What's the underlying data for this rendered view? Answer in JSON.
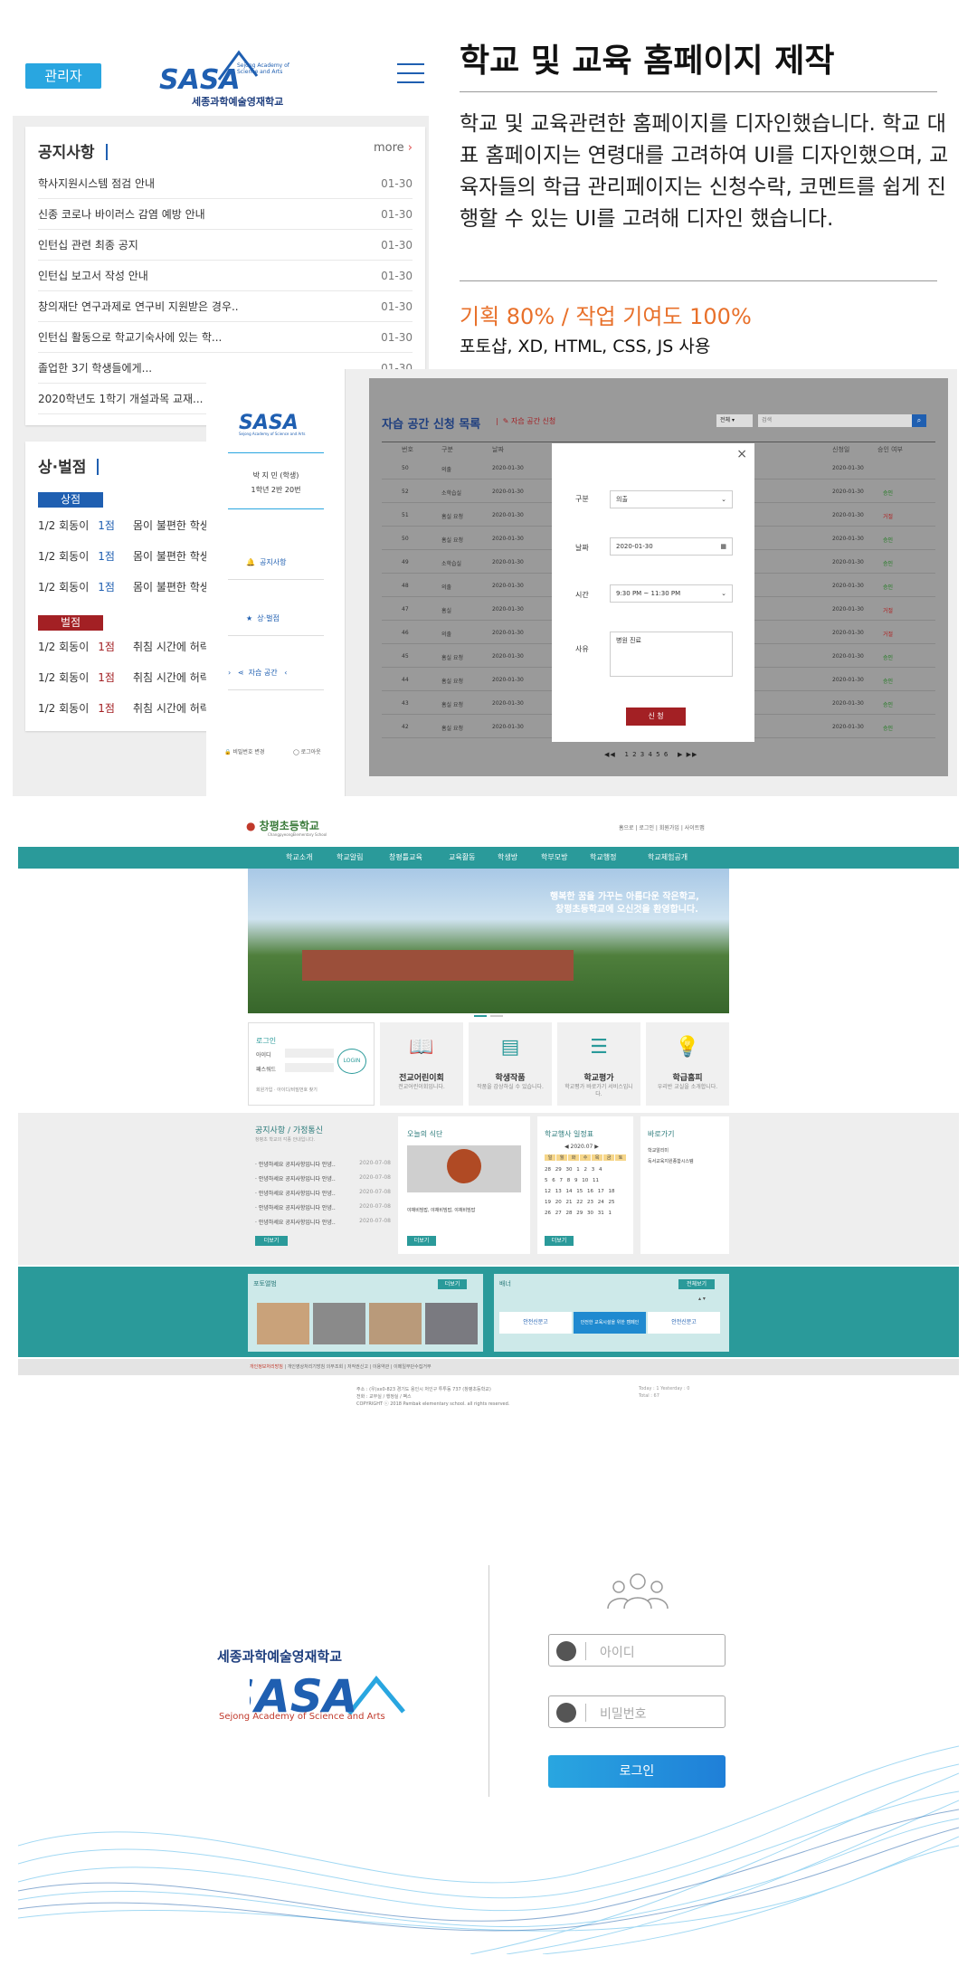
{
  "section1": {
    "admin_button": "관리자",
    "school_logo_text": "SASA",
    "school_name": "세종과학예술영재학교",
    "school_name_en_1": "Sejong Academy of",
    "school_name_en_2": "Science and Arts",
    "notice": {
      "title": "공지사항",
      "more": "more",
      "rows": [
        {
          "title": "학사지원시스템 점검 안내",
          "date": "01-30"
        },
        {
          "title": "신종 코로나 바이러스 감염 예방 안내",
          "date": "01-30"
        },
        {
          "title": "인턴십 관련 최종 공지",
          "date": "01-30"
        },
        {
          "title": "인턴십 보고서 작성 안내",
          "date": "01-30"
        },
        {
          "title": "창의재단 연구과제로 연구비 지원받은 경우..",
          "date": "01-30"
        },
        {
          "title": "인턴십 활동으로 학교기숙사에 있는 학...",
          "date": "01-30"
        },
        {
          "title": "졸업한 3기 학생들에게...",
          "date": "01-30"
        },
        {
          "title": "2020학년도 1학기 개설과목 교재...",
          "date": "01-30"
        }
      ]
    },
    "points": {
      "title": "상·벌점",
      "merit_label": "상점",
      "demerit_label": "벌점",
      "merit_rows": [
        {
          "period": "1/2 회동이",
          "score": "1점",
          "reason": "몸이 불편한 학생"
        },
        {
          "period": "1/2 회동이",
          "score": "1점",
          "reason": "몸이 불편한 학생"
        },
        {
          "period": "1/2 회동이",
          "score": "1점",
          "reason": "몸이 불편한 학생"
        }
      ],
      "demerit_rows": [
        {
          "period": "1/2 회동이",
          "score": "1점",
          "reason": "취침 시간에 허락"
        },
        {
          "period": "1/2 회동이",
          "score": "1점",
          "reason": "취침 시간에 허락"
        },
        {
          "period": "1/2 회동이",
          "score": "1점",
          "reason": "취침 시간에 허락"
        }
      ]
    }
  },
  "desktop_mock": {
    "logo": "SASA",
    "logo_sub": "Sejong Academy of Science and Arts",
    "user_name": "박 지 민 (학생)",
    "user_class": "1학년 2반 20번",
    "menu": [
      "공지사항",
      "상·벌점",
      "자습 공간"
    ],
    "footer_links": [
      "비밀번호 변경",
      "로그아웃"
    ],
    "page_title": "자습 공간 신청 목록",
    "apply_link": "자습 공간 신청",
    "filter_select": "전체",
    "search_placeholder": "검색",
    "columns": [
      "번호",
      "구분",
      "날짜",
      "신청일",
      "승인 여부"
    ],
    "rows": [
      {
        "no": "50",
        "type": "의출",
        "date": "2020-01-30",
        "applied": "2020-01-30",
        "status": ""
      },
      {
        "no": "52",
        "type": "소학습실",
        "date": "2020-01-30",
        "applied": "2020-01-30",
        "status": "승인"
      },
      {
        "no": "51",
        "type": "홈실 요청",
        "date": "2020-01-30",
        "applied": "2020-01-30",
        "status": "거절"
      },
      {
        "no": "50",
        "type": "홈실 요청",
        "date": "2020-01-30",
        "applied": "2020-01-30",
        "status": "승인"
      },
      {
        "no": "49",
        "type": "소학습실",
        "date": "2020-01-30",
        "applied": "2020-01-30",
        "status": "승인"
      },
      {
        "no": "48",
        "type": "의출",
        "date": "2020-01-30",
        "applied": "2020-01-30",
        "status": "승인"
      },
      {
        "no": "47",
        "type": "홈실",
        "date": "2020-01-30",
        "applied": "2020-01-30",
        "status": "거절"
      },
      {
        "no": "46",
        "type": "의출",
        "date": "2020-01-30",
        "applied": "2020-01-30",
        "status": "거절"
      },
      {
        "no": "45",
        "type": "홈실 요청",
        "date": "2020-01-30",
        "applied": "2020-01-30",
        "status": "승인"
      },
      {
        "no": "44",
        "type": "홈실 요청",
        "date": "2020-01-30",
        "applied": "2020-01-30",
        "status": "승인"
      },
      {
        "no": "43",
        "type": "홈실 요청",
        "date": "2020-01-30",
        "applied": "2020-01-30",
        "status": "승인"
      },
      {
        "no": "42",
        "type": "홈실 요청",
        "date": "2020-01-30",
        "applied": "2020-01-30",
        "status": "승인"
      }
    ],
    "pagination": "1 2 3 4 5 6",
    "modal": {
      "type_label": "구분",
      "type_value": "의출",
      "date_label": "날짜",
      "date_value": "2020-01-30",
      "time_label": "시간",
      "time_value": "9:30 PM ~ 11:30 PM",
      "reason_label": "사유",
      "reason_value": "병원 진료",
      "submit": "신 청"
    }
  },
  "intro": {
    "title": "학교 및 교육 홈페이지 제작",
    "body": "학교 및 교육관련한 홈페이지를 디자인했습니다. 학교 대표 홈페이지는 연령대를 고려하여 UI를 디자인했으며, 교육자들의 학급 관리페이지는 신청수락, 코멘트를 쉽게 진행할 수 있는 UI를 고려해 디자인 했습니다.",
    "contribution": "기획 80% / 작업 기여도 100%",
    "tools": "포토샵, XD, HTML, CSS, JS 사용"
  },
  "school_site": {
    "name": "창평초등학교",
    "name_en": "ChangpyeongElementary School",
    "top_links": [
      "홈으로",
      "로그인",
      "회원가입",
      "사이트맵"
    ],
    "gnb": [
      "학교소개",
      "학교알림",
      "창평틀교육",
      "교육활동",
      "학생방",
      "학부모방",
      "학교행정",
      "학교체험공개"
    ],
    "hero_line1": "행복한 꿈을 가꾸는 아름다운 작은학교,",
    "hero_line2": "창평초등학교에 오신것을 환영합니다.",
    "login": {
      "title": "로그인",
      "id": "아이디",
      "pw": "패스워드",
      "button": "LOGIN",
      "links": "회원가입 · 아이디/비밀번호 찾기"
    },
    "quick": [
      {
        "title": "전교어린이회",
        "sub": "전교어린이회입니다."
      },
      {
        "title": "학생작품",
        "sub": "작품을 감상하실 수 있습니다."
      },
      {
        "title": "학교평가",
        "sub": "학교평가 바로가기 서비스입니다."
      },
      {
        "title": "학급홈피",
        "sub": "우리반 교실을 소개합니다."
      }
    ],
    "notice_title": "공지사항 / 가정통신",
    "notice_sub": "창평초 학교의 각종 안내입니다.",
    "notice_rows": [
      {
        "t": "· 안녕하세요 공지사항입니다 안녕..",
        "d": "2020-07-08"
      },
      {
        "t": "· 안녕하세요 공지사항입니다 안녕..",
        "d": "2020-07-08"
      },
      {
        "t": "· 안녕하세요 공지사항입니다 안녕..",
        "d": "2020-07-08"
      },
      {
        "t": "· 안녕하세요 공지사항입니다 안녕..",
        "d": "2020-07-08"
      },
      {
        "t": "· 안녕하세요 공지사항입니다 안녕..",
        "d": "2020-07-08"
      }
    ],
    "more": "더보기",
    "meal_title": "오늘의 식단",
    "meal_text": "야채비빔밥, 야채비빔밥, 야채비빔밥",
    "calendar_title": "학교행사 일정표",
    "calendar_month": "2020.07",
    "calendar_weekdays": [
      "일",
      "월",
      "화",
      "수",
      "목",
      "금",
      "토"
    ],
    "calendar_weeks": [
      "28 29 30 1 2 3 4",
      "5 6 7 8 9 10 11",
      "12 13 14 15 16 17 18",
      "19 20 21 22 23 24 25",
      "26 27 28 29 30 31 1"
    ],
    "shortcut_title": "바로가기",
    "shortcut_items": [
      "학교알리미",
      "독서교육지원종합시스템"
    ],
    "photo_title": "포토앨범",
    "banner_title": "배너",
    "banner_all": "전체보기",
    "banner_items": [
      "안전신문고",
      "안전한 교육시설을 위한 캠페인",
      "안전신문고"
    ],
    "footer_links": [
      "개인정보처리방침",
      "개인영상처리기방침 의무조회",
      "저작권신고",
      "이용약관",
      "이메일무단수집거부"
    ],
    "address": "주소 : (우)xx0-823 경기도 용인시 처인구 투투동 737 (창평초등학교)",
    "phone": "전화 : 교무실 / 행정실 / 팩스",
    "copyright": "COPYRIGHT ⓒ 2018 Pambak elementary school. all rights reserved.",
    "today": "Today : 1   Yesterday : 0",
    "total": "Total : 67"
  },
  "login_page": {
    "school_name": "세종과학예술영재학교",
    "logo": "SASA",
    "school_name_en": "Sejong Academy of Science and Arts",
    "id_placeholder": "아이디",
    "pw_placeholder": "비밀번호",
    "login_button": "로그인"
  },
  "colors": {
    "brand_blue": "#1f5fb1",
    "sky": "#29a6e0",
    "teal": "#2a9a9a",
    "merit": "#1f5fb1",
    "demerit": "#a32024",
    "accent_orange": "#e8702a"
  }
}
